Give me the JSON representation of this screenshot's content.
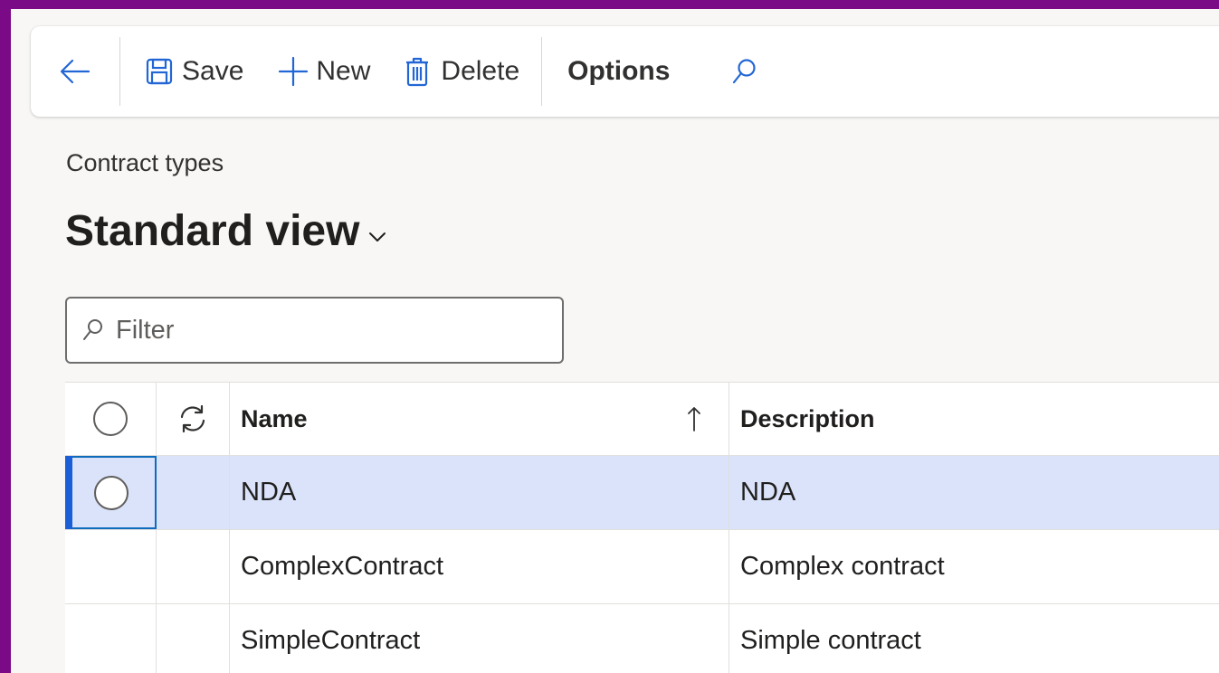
{
  "toolbar": {
    "back_icon": "back-arrow-icon",
    "save_label": "Save",
    "new_label": "New",
    "delete_label": "Delete",
    "options_label": "Options",
    "search_icon": "search-icon"
  },
  "page": {
    "subtitle": "Contract types",
    "title": "Standard view"
  },
  "filter": {
    "placeholder": "Filter",
    "value": ""
  },
  "grid": {
    "columns": {
      "name": "Name",
      "description": "Description"
    },
    "sort": "Name ascending",
    "rows": [
      {
        "name": "NDA",
        "description": "NDA",
        "selected": true
      },
      {
        "name": "ComplexContract",
        "description": "Complex contract",
        "selected": false
      },
      {
        "name": "SimpleContract",
        "description": "Simple contract",
        "selected": false
      }
    ]
  },
  "colors": {
    "frame": "#7a0a85",
    "accent": "#0f6cbd",
    "selected_row": "#dae3f9"
  }
}
